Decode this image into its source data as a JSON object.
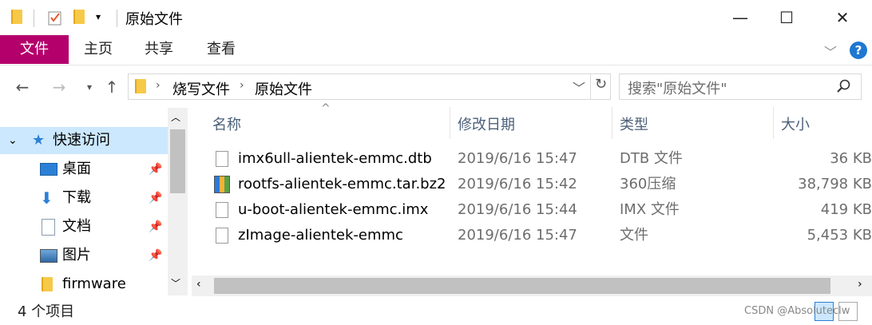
{
  "window": {
    "title": "原始文件",
    "controls": {
      "minimize": "—",
      "maximize": "☐",
      "close": "✕"
    }
  },
  "ribbon": {
    "tabs": [
      "文件",
      "主页",
      "共享",
      "查看"
    ],
    "help": "?"
  },
  "address_bar": {
    "breadcrumb": [
      "烧写文件",
      "原始文件"
    ],
    "search_placeholder": "搜索\"原始文件\""
  },
  "nav_pane": {
    "items": [
      {
        "label": "快速访问",
        "icon": "star-icon",
        "selected": true
      },
      {
        "label": "桌面",
        "icon": "desktop-icon",
        "pinned": true
      },
      {
        "label": "下载",
        "icon": "download-icon",
        "pinned": true
      },
      {
        "label": "文档",
        "icon": "document-icon",
        "pinned": true
      },
      {
        "label": "图片",
        "icon": "picture-icon",
        "pinned": true
      },
      {
        "label": "firmware",
        "icon": "folder-icon",
        "pinned": false
      }
    ]
  },
  "file_list": {
    "columns": [
      "名称",
      "修改日期",
      "类型",
      "大小"
    ],
    "rows": [
      {
        "name": "imx6ull-alientek-emmc.dtb",
        "date": "2019/6/16 15:47",
        "type": "DTB 文件",
        "size": "36 KB",
        "icon": "file-icon"
      },
      {
        "name": "rootfs-alientek-emmc.tar.bz2",
        "date": "2019/6/16 15:42",
        "type": "360压缩",
        "size": "38,798 KB",
        "icon": "archive-icon"
      },
      {
        "name": "u-boot-alientek-emmc.imx",
        "date": "2019/6/16 15:44",
        "type": "IMX 文件",
        "size": "419 KB",
        "icon": "file-icon"
      },
      {
        "name": "zImage-alientek-emmc",
        "date": "2019/6/16 15:47",
        "type": "文件",
        "size": "5,453 KB",
        "icon": "file-icon"
      }
    ]
  },
  "status_bar": {
    "item_count": "4 个项目"
  },
  "watermark": "CSDN @Absoluteclw",
  "colors": {
    "file_tab": "#b4006b",
    "selection": "#cce8ff",
    "help": "#1e78d2"
  }
}
